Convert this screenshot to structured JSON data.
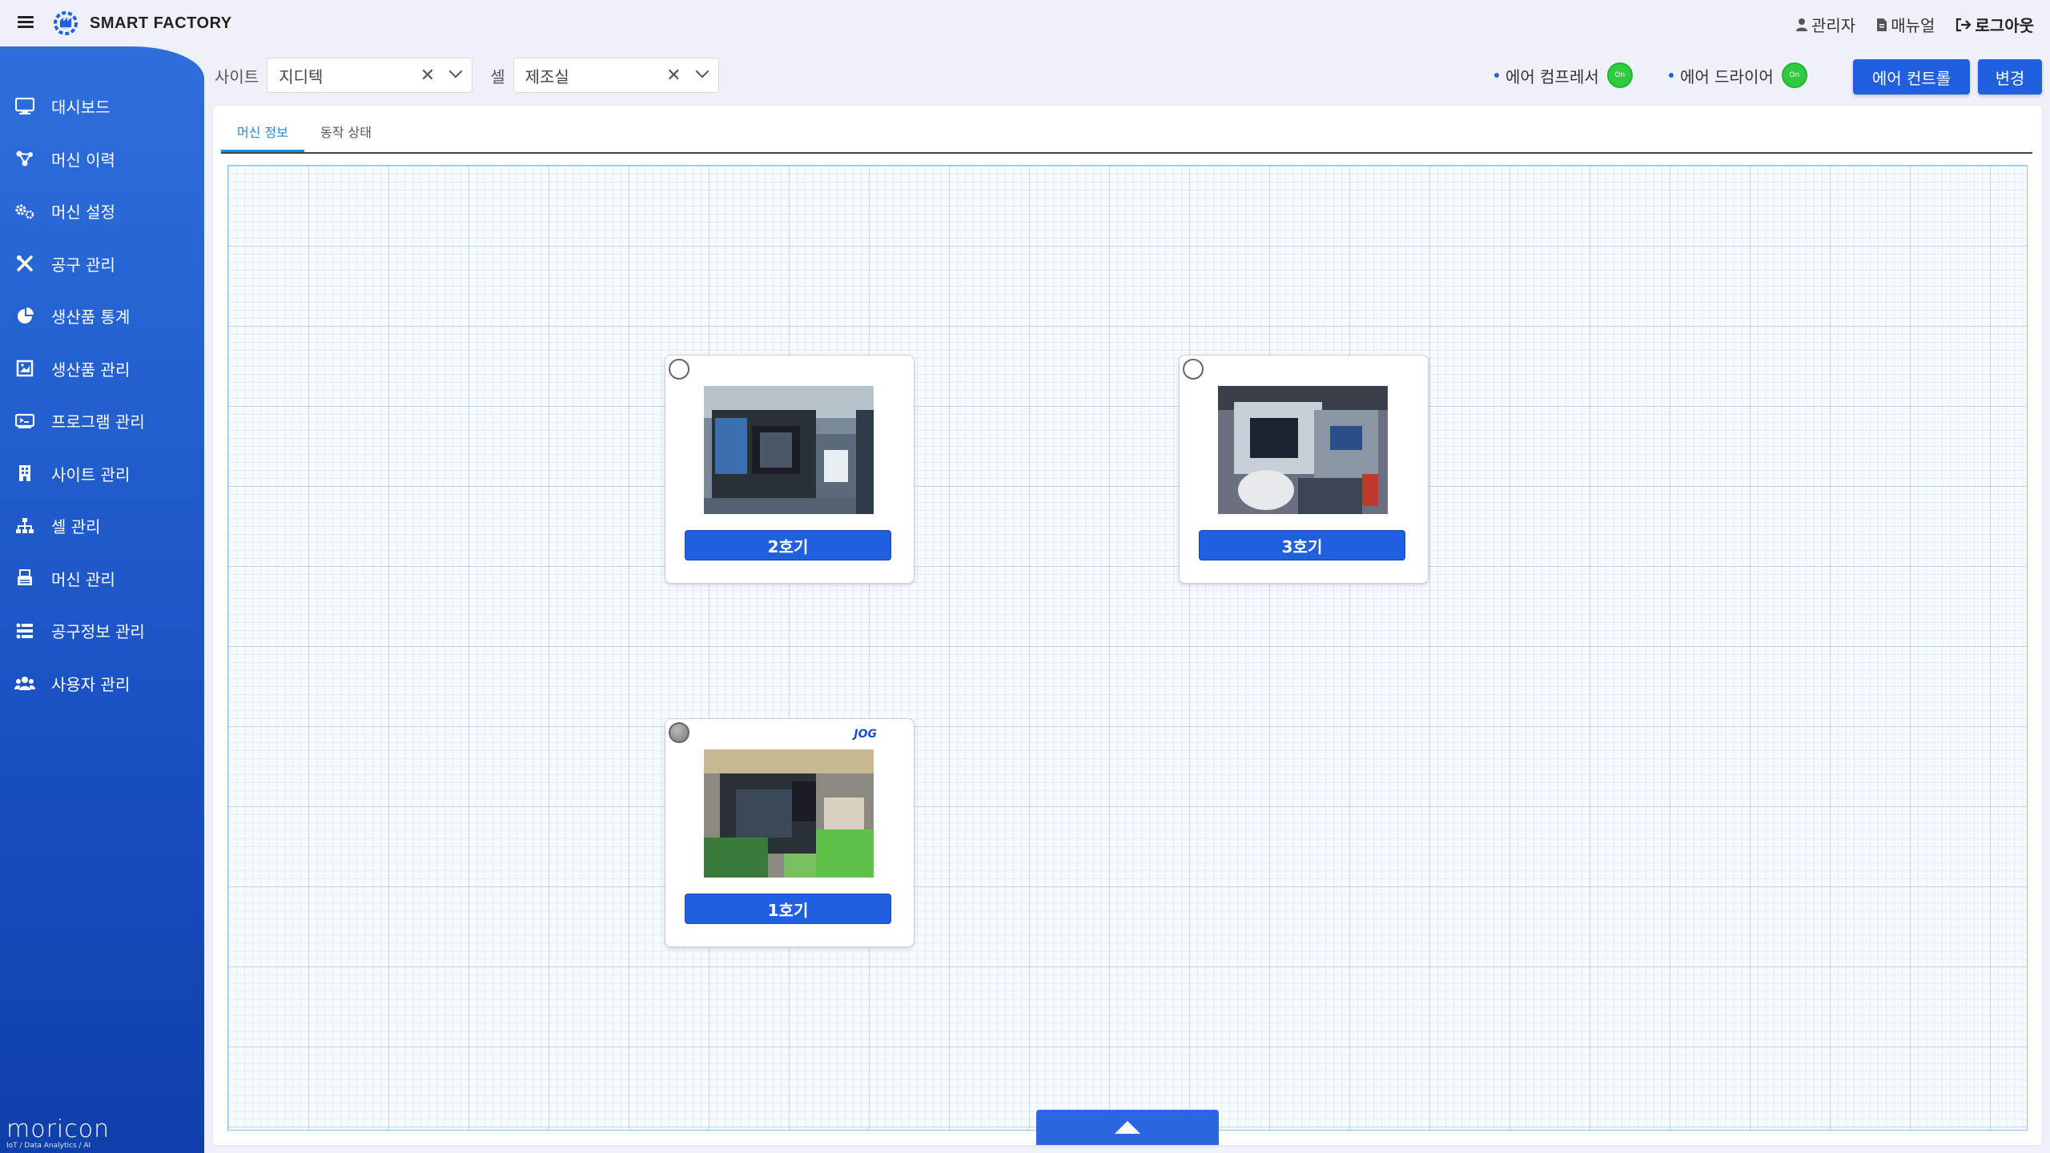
{
  "header": {
    "brand": "SMART FACTORY",
    "admin_label": "관리자",
    "manual_label": "매뉴얼",
    "logout_label": "로그아웃"
  },
  "sidebar": {
    "items": [
      {
        "label": "대시보드",
        "icon": "monitor-icon"
      },
      {
        "label": "머신 이력",
        "icon": "network-icon"
      },
      {
        "label": "머신 설정",
        "icon": "gears-icon"
      },
      {
        "label": "공구 관리",
        "icon": "tools-icon"
      },
      {
        "label": "생산품 통계",
        "icon": "pie-chart-icon"
      },
      {
        "label": "생산품 관리",
        "icon": "image-frame-icon"
      },
      {
        "label": "프로그램 관리",
        "icon": "terminal-icon"
      },
      {
        "label": "사이트 관리",
        "icon": "building-icon"
      },
      {
        "label": "셀 관리",
        "icon": "sitemap-icon"
      },
      {
        "label": "머신 관리",
        "icon": "printer-icon"
      },
      {
        "label": "공구정보 관리",
        "icon": "tool-list-icon"
      },
      {
        "label": "사용자 관리",
        "icon": "users-icon"
      }
    ],
    "footer_name": "moricon",
    "footer_sub": "IoT / Data Analytics / AI"
  },
  "filters": {
    "site_label": "사이트",
    "site_value": "지디텍",
    "cell_label": "셀",
    "cell_value": "제조실"
  },
  "status": {
    "compressor_label": "에어 컴프레서",
    "compressor_state": "On",
    "dryer_label": "에어 드라이어",
    "dryer_state": "On"
  },
  "actions": {
    "air_control_label": "에어 컨트롤",
    "change_label": "변경"
  },
  "tabs": [
    {
      "label": "머신 정보",
      "active": true
    },
    {
      "label": "동작 상태",
      "active": false
    }
  ],
  "machines": [
    {
      "name": "2호기",
      "status": "idle",
      "badge": ""
    },
    {
      "name": "3호기",
      "status": "idle",
      "badge": ""
    },
    {
      "name": "1호기",
      "status": "grey",
      "badge": "JOG"
    }
  ],
  "colors": {
    "primary": "#1f5fe0",
    "sidebar": "#2e6fdc",
    "on": "#2ecc40",
    "tab_active": "#1f8ad8"
  }
}
